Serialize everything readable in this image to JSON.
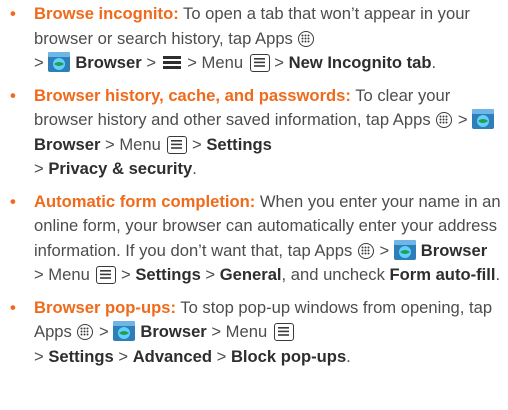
{
  "colors": {
    "accent": "#ef6a1b",
    "text": "#4d4d4d",
    "bold_text": "#2e2e2e"
  },
  "bullet_char": "•",
  "tips": [
    {
      "title": "Browse incognito:",
      "text_1": " To open a tab that won’t appear in your browser or search history, tap Apps ",
      "sep_1": "> ",
      "browser": "Browser",
      "sep_2": " > ",
      "sep_3": " > Menu ",
      "sep_4": " > ",
      "end_bold": "New Incognito tab",
      "period": "."
    },
    {
      "title": "Browser history, cache, and passwords:",
      "text_1": " To clear your browser history and other saved information, tap Apps ",
      "sep_1": " > ",
      "browser": "Browser",
      "sep_2": " > Menu ",
      "sep_3": " > ",
      "settings": "Settings",
      "sep_4": "> ",
      "end_bold": "Privacy & security",
      "period": "."
    },
    {
      "title": "Automatic form completion:",
      "text_1": " When you enter your name in an online form, your browser can automatically enter your address information. If you don’t want that, tap Apps ",
      "sep_1": " > ",
      "browser": "Browser",
      "sep_2": "> Menu ",
      "sep_3": " > ",
      "settings": "Settings",
      "sep_4": " > ",
      "general": "General",
      "text_2": ", and uncheck ",
      "end_bold": "Form auto-fill",
      "period": "."
    },
    {
      "title": "Browser pop-ups:",
      "text_1": " To stop pop-up windows from opening, tap Apps ",
      "sep_1": " > ",
      "browser": "Browser",
      "sep_2": " > Menu ",
      "sep_3": "> ",
      "settings": "Settings",
      "sep_4": " > ",
      "advanced": "Advanced",
      "sep_5": " > ",
      "end_bold": "Block pop-ups",
      "period": "."
    }
  ],
  "icons": {
    "apps": "apps-icon",
    "browser": "browser-icon",
    "menu_key": "menu-key-icon",
    "overflow": "overflow-bars-icon"
  }
}
